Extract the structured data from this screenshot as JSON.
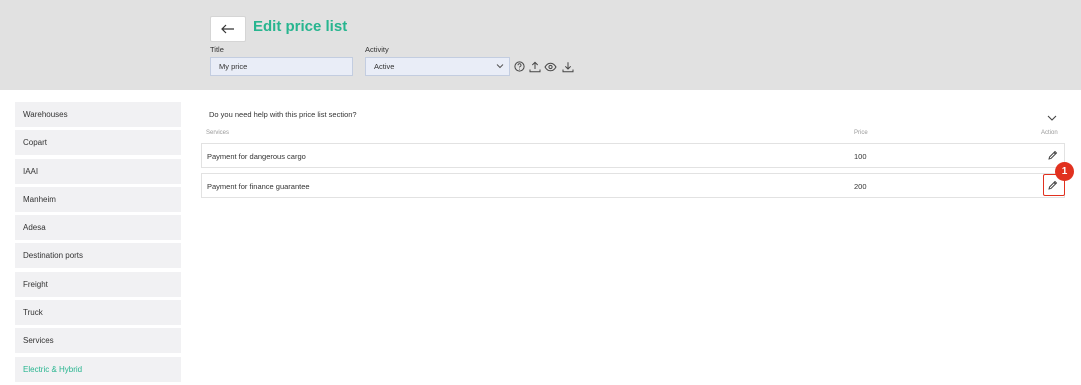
{
  "header": {
    "title": "Edit price list",
    "title_label": "Title",
    "title_value": "My price",
    "activity_label": "Activity",
    "activity_value": "Active",
    "icons": [
      "help-icon",
      "upload-icon",
      "view-icon",
      "download-icon"
    ]
  },
  "sidebar": {
    "items": [
      {
        "label": "Warehouses"
      },
      {
        "label": "Copart"
      },
      {
        "label": "IAAI"
      },
      {
        "label": "Manheim"
      },
      {
        "label": "Adesa"
      },
      {
        "label": "Destination ports"
      },
      {
        "label": "Freight"
      },
      {
        "label": "Truck"
      },
      {
        "label": "Services"
      },
      {
        "label": "Electric & Hybrid",
        "active": true
      }
    ]
  },
  "main": {
    "help_text": "Do you need help with this price list section?",
    "columns": {
      "services": "Services",
      "price": "Price",
      "action": "Action"
    },
    "rows": [
      {
        "service": "Payment for dangerous cargo",
        "price": "100"
      },
      {
        "service": "Payment for finance guarantee",
        "price": "200"
      }
    ]
  },
  "annotation": {
    "badge": "1",
    "color": "#e1311f"
  },
  "colors": {
    "accent": "#27b58f",
    "header_bg": "#e1e1e1",
    "input_bg": "#e9edf7"
  }
}
